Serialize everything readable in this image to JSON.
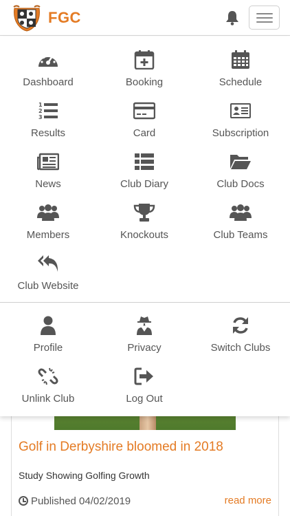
{
  "brand": {
    "name": "FGC",
    "color": "#e47b24"
  },
  "header": {
    "bell_icon": "bell-icon",
    "menu_icon": "hamburger-icon"
  },
  "menu": {
    "items": [
      {
        "label": "Dashboard",
        "icon": "dashboard-gauge-icon"
      },
      {
        "label": "Booking",
        "icon": "calendar-plus-icon"
      },
      {
        "label": "Schedule",
        "icon": "calendar-grid-icon"
      },
      {
        "label": "Results",
        "icon": "ordered-list-icon"
      },
      {
        "label": "Card",
        "icon": "credit-card-icon"
      },
      {
        "label": "Subscription",
        "icon": "id-card-icon"
      },
      {
        "label": "News",
        "icon": "newspaper-icon"
      },
      {
        "label": "Club Diary",
        "icon": "list-table-icon"
      },
      {
        "label": "Club Docs",
        "icon": "folder-open-icon"
      },
      {
        "label": "Members",
        "icon": "users-icon"
      },
      {
        "label": "Knockouts",
        "icon": "trophy-icon"
      },
      {
        "label": "Club Teams",
        "icon": "team-icon"
      },
      {
        "label": "Club Website",
        "icon": "reply-all-icon"
      }
    ],
    "account_items": [
      {
        "label": "Profile",
        "icon": "user-icon"
      },
      {
        "label": "Privacy",
        "icon": "user-secret-icon"
      },
      {
        "label": "Switch Clubs",
        "icon": "refresh-icon"
      },
      {
        "label": "Unlink Club",
        "icon": "unlink-icon"
      },
      {
        "label": "Log Out",
        "icon": "sign-out-icon"
      }
    ]
  },
  "news_card": {
    "title": "Golf in Derbyshire bloomed in 2018",
    "subtitle": "Study Showing Golfing Growth",
    "published": "Published 04/02/2019",
    "read_more": "read more"
  }
}
